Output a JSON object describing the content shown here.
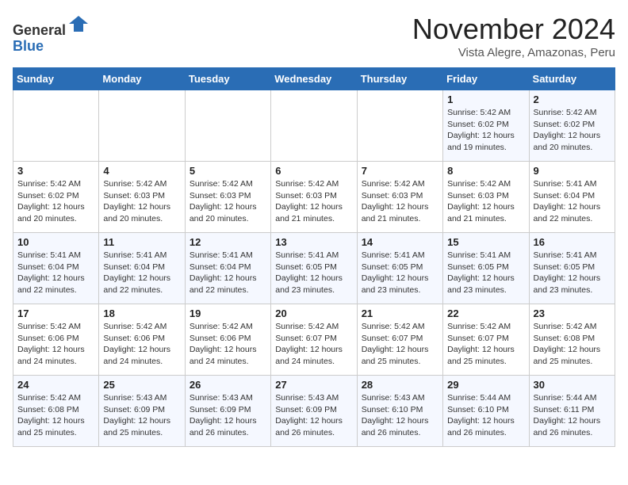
{
  "header": {
    "logo_line1": "General",
    "logo_line2": "Blue",
    "month": "November 2024",
    "location": "Vista Alegre, Amazonas, Peru"
  },
  "days_of_week": [
    "Sunday",
    "Monday",
    "Tuesday",
    "Wednesday",
    "Thursday",
    "Friday",
    "Saturday"
  ],
  "weeks": [
    [
      {
        "num": "",
        "info": ""
      },
      {
        "num": "",
        "info": ""
      },
      {
        "num": "",
        "info": ""
      },
      {
        "num": "",
        "info": ""
      },
      {
        "num": "",
        "info": ""
      },
      {
        "num": "1",
        "info": "Sunrise: 5:42 AM\nSunset: 6:02 PM\nDaylight: 12 hours\nand 19 minutes."
      },
      {
        "num": "2",
        "info": "Sunrise: 5:42 AM\nSunset: 6:02 PM\nDaylight: 12 hours\nand 20 minutes."
      }
    ],
    [
      {
        "num": "3",
        "info": "Sunrise: 5:42 AM\nSunset: 6:02 PM\nDaylight: 12 hours\nand 20 minutes."
      },
      {
        "num": "4",
        "info": "Sunrise: 5:42 AM\nSunset: 6:03 PM\nDaylight: 12 hours\nand 20 minutes."
      },
      {
        "num": "5",
        "info": "Sunrise: 5:42 AM\nSunset: 6:03 PM\nDaylight: 12 hours\nand 20 minutes."
      },
      {
        "num": "6",
        "info": "Sunrise: 5:42 AM\nSunset: 6:03 PM\nDaylight: 12 hours\nand 21 minutes."
      },
      {
        "num": "7",
        "info": "Sunrise: 5:42 AM\nSunset: 6:03 PM\nDaylight: 12 hours\nand 21 minutes."
      },
      {
        "num": "8",
        "info": "Sunrise: 5:42 AM\nSunset: 6:03 PM\nDaylight: 12 hours\nand 21 minutes."
      },
      {
        "num": "9",
        "info": "Sunrise: 5:41 AM\nSunset: 6:04 PM\nDaylight: 12 hours\nand 22 minutes."
      }
    ],
    [
      {
        "num": "10",
        "info": "Sunrise: 5:41 AM\nSunset: 6:04 PM\nDaylight: 12 hours\nand 22 minutes."
      },
      {
        "num": "11",
        "info": "Sunrise: 5:41 AM\nSunset: 6:04 PM\nDaylight: 12 hours\nand 22 minutes."
      },
      {
        "num": "12",
        "info": "Sunrise: 5:41 AM\nSunset: 6:04 PM\nDaylight: 12 hours\nand 22 minutes."
      },
      {
        "num": "13",
        "info": "Sunrise: 5:41 AM\nSunset: 6:05 PM\nDaylight: 12 hours\nand 23 minutes."
      },
      {
        "num": "14",
        "info": "Sunrise: 5:41 AM\nSunset: 6:05 PM\nDaylight: 12 hours\nand 23 minutes."
      },
      {
        "num": "15",
        "info": "Sunrise: 5:41 AM\nSunset: 6:05 PM\nDaylight: 12 hours\nand 23 minutes."
      },
      {
        "num": "16",
        "info": "Sunrise: 5:41 AM\nSunset: 6:05 PM\nDaylight: 12 hours\nand 23 minutes."
      }
    ],
    [
      {
        "num": "17",
        "info": "Sunrise: 5:42 AM\nSunset: 6:06 PM\nDaylight: 12 hours\nand 24 minutes."
      },
      {
        "num": "18",
        "info": "Sunrise: 5:42 AM\nSunset: 6:06 PM\nDaylight: 12 hours\nand 24 minutes."
      },
      {
        "num": "19",
        "info": "Sunrise: 5:42 AM\nSunset: 6:06 PM\nDaylight: 12 hours\nand 24 minutes."
      },
      {
        "num": "20",
        "info": "Sunrise: 5:42 AM\nSunset: 6:07 PM\nDaylight: 12 hours\nand 24 minutes."
      },
      {
        "num": "21",
        "info": "Sunrise: 5:42 AM\nSunset: 6:07 PM\nDaylight: 12 hours\nand 25 minutes."
      },
      {
        "num": "22",
        "info": "Sunrise: 5:42 AM\nSunset: 6:07 PM\nDaylight: 12 hours\nand 25 minutes."
      },
      {
        "num": "23",
        "info": "Sunrise: 5:42 AM\nSunset: 6:08 PM\nDaylight: 12 hours\nand 25 minutes."
      }
    ],
    [
      {
        "num": "24",
        "info": "Sunrise: 5:42 AM\nSunset: 6:08 PM\nDaylight: 12 hours\nand 25 minutes."
      },
      {
        "num": "25",
        "info": "Sunrise: 5:43 AM\nSunset: 6:09 PM\nDaylight: 12 hours\nand 25 minutes."
      },
      {
        "num": "26",
        "info": "Sunrise: 5:43 AM\nSunset: 6:09 PM\nDaylight: 12 hours\nand 26 minutes."
      },
      {
        "num": "27",
        "info": "Sunrise: 5:43 AM\nSunset: 6:09 PM\nDaylight: 12 hours\nand 26 minutes."
      },
      {
        "num": "28",
        "info": "Sunrise: 5:43 AM\nSunset: 6:10 PM\nDaylight: 12 hours\nand 26 minutes."
      },
      {
        "num": "29",
        "info": "Sunrise: 5:44 AM\nSunset: 6:10 PM\nDaylight: 12 hours\nand 26 minutes."
      },
      {
        "num": "30",
        "info": "Sunrise: 5:44 AM\nSunset: 6:11 PM\nDaylight: 12 hours\nand 26 minutes."
      }
    ]
  ]
}
